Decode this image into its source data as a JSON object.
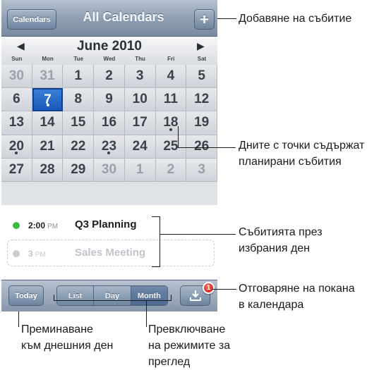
{
  "nav": {
    "calendars_label": "Calendars",
    "title": "All Calendars",
    "add_label": "+"
  },
  "month": {
    "prev": "◀",
    "next": "▶",
    "title": "June 2010",
    "weekdays": [
      "Sun",
      "Mon",
      "Tue",
      "Wed",
      "Thu",
      "Fri",
      "Sat"
    ]
  },
  "grid": [
    [
      {
        "d": "30",
        "other": true
      },
      {
        "d": "31",
        "other": true
      },
      {
        "d": "1"
      },
      {
        "d": "2"
      },
      {
        "d": "3"
      },
      {
        "d": "4"
      },
      {
        "d": "5"
      }
    ],
    [
      {
        "d": "6"
      },
      {
        "d": "7",
        "selected": true,
        "dot": true
      },
      {
        "d": "8"
      },
      {
        "d": "9"
      },
      {
        "d": "10"
      },
      {
        "d": "11"
      },
      {
        "d": "12"
      }
    ],
    [
      {
        "d": "13"
      },
      {
        "d": "14"
      },
      {
        "d": "15"
      },
      {
        "d": "16"
      },
      {
        "d": "17"
      },
      {
        "d": "18",
        "dot": true
      },
      {
        "d": "19"
      }
    ],
    [
      {
        "d": "20",
        "dot": true
      },
      {
        "d": "21"
      },
      {
        "d": "22"
      },
      {
        "d": "23",
        "dot": true
      },
      {
        "d": "24"
      },
      {
        "d": "25"
      },
      {
        "d": "26"
      }
    ],
    [
      {
        "d": "27"
      },
      {
        "d": "28"
      },
      {
        "d": "29"
      },
      {
        "d": "30",
        "other": true
      },
      {
        "d": "1",
        "other": true
      },
      {
        "d": "2",
        "other": true
      },
      {
        "d": "3",
        "other": true
      }
    ]
  ],
  "events": [
    {
      "time": "2:00",
      "ampm": "PM",
      "title": "Q3 Planning",
      "color": "#3cba43"
    },
    {
      "time": "3",
      "ampm": "PM",
      "title": "Sales Meeting",
      "color": "#c6c9ce"
    }
  ],
  "toolbar": {
    "today": "Today",
    "modes": [
      "List",
      "Day",
      "Month"
    ],
    "active_mode": "Month",
    "invite_icon": "download-tray-icon",
    "badge": "1"
  },
  "callouts": {
    "add_event": "Добавяне на събитие",
    "dots_line1": "Дните с точки съдържат",
    "dots_line2": "планирани събития",
    "events_line1": "Събитията през",
    "events_line2": "избрания ден",
    "invite_line1": "Отговаряне на покана",
    "invite_line2": "в календара",
    "today_line1": "Преминаване",
    "today_line2": "към днешния ден",
    "views_line1": "Превключване",
    "views_line2": "на режимите за",
    "views_line3": "преглед"
  }
}
